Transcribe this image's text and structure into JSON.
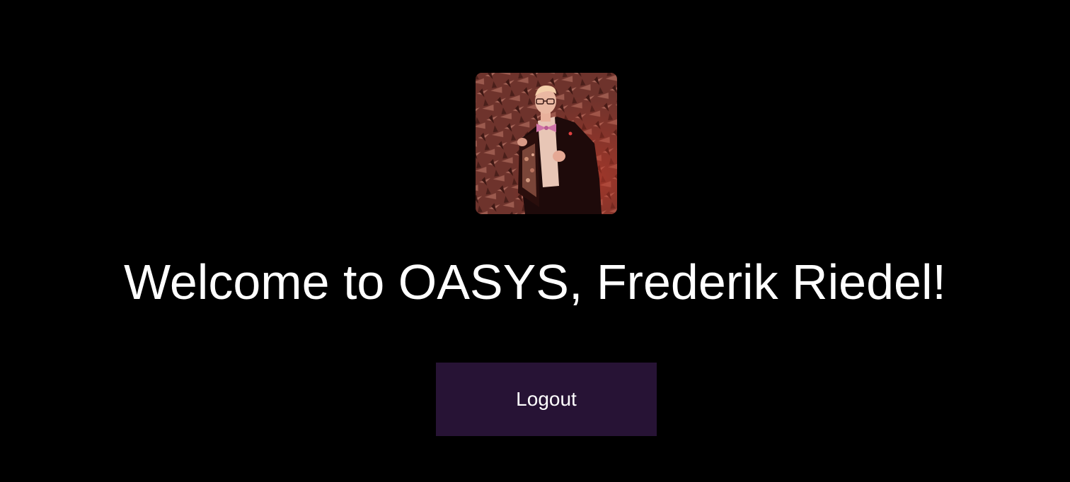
{
  "profile": {
    "avatar_icon": "profile-photo",
    "avatar_alt": "Frederik Riedel"
  },
  "welcome": {
    "text": "Welcome to OASYS, Frederik Riedel!"
  },
  "actions": {
    "logout_label": "Logout"
  },
  "colors": {
    "background": "#000000",
    "text": "#ffffff",
    "button_bg": "#271335"
  }
}
